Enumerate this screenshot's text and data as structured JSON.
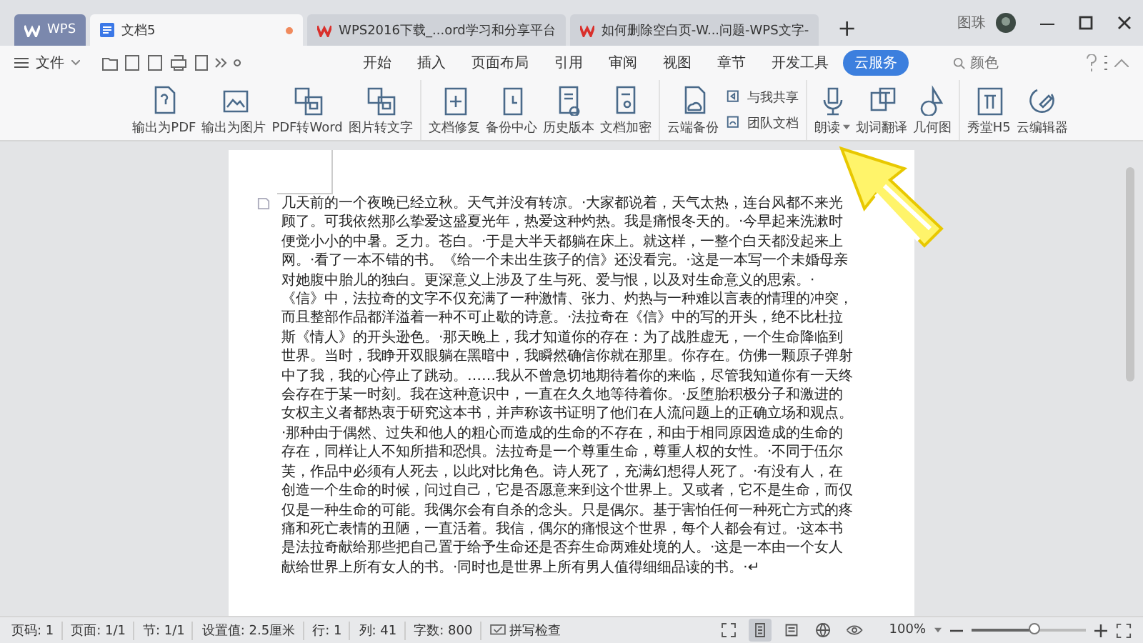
{
  "window": {
    "tabs": [
      {
        "kind": "logo",
        "label": "WPS",
        "selected": false
      },
      {
        "kind": "doc",
        "label": "文档5",
        "selected": true
      },
      {
        "kind": "web",
        "label": "WPS2016下载_...ord学习和分享平台",
        "selected": false
      },
      {
        "kind": "web",
        "label": "如何删除空白页-W...问题-WPS文字-",
        "selected": false
      }
    ],
    "new_tab": "+",
    "user": "图珠"
  },
  "menu": {
    "file": "文件"
  },
  "ribbon_tabs": [
    {
      "label": "开始",
      "selected": false
    },
    {
      "label": "插入",
      "selected": false
    },
    {
      "label": "页面布局",
      "selected": false
    },
    {
      "label": "引用",
      "selected": false
    },
    {
      "label": "审阅",
      "selected": false
    },
    {
      "label": "视图",
      "selected": false
    },
    {
      "label": "章节",
      "selected": false
    },
    {
      "label": "开发工具",
      "selected": false
    },
    {
      "label": "云服务",
      "selected": true
    }
  ],
  "search": {
    "placeholder": "颜色"
  },
  "ribbon_groups": [
    [
      {
        "kind": "large",
        "label": "输出为PDF"
      },
      {
        "kind": "large",
        "label": "输出为图片"
      },
      {
        "kind": "large",
        "label": "PDF转Word"
      },
      {
        "kind": "large",
        "label": "图片转文字"
      }
    ],
    [
      {
        "kind": "large",
        "label": "文档修复"
      },
      {
        "kind": "large",
        "label": "备份中心"
      },
      {
        "kind": "large",
        "label": "历史版本"
      },
      {
        "kind": "large",
        "label": "文档加密"
      }
    ],
    [
      {
        "kind": "large",
        "label": "云端备份"
      },
      {
        "kind": "small",
        "label": "与我共享"
      },
      {
        "kind": "small",
        "label": "团队文档"
      }
    ],
    [
      {
        "kind": "dropdown",
        "label": "朗读"
      },
      {
        "kind": "large",
        "label": "划词翻译"
      },
      {
        "kind": "large",
        "label": "几何图"
      }
    ],
    [
      {
        "kind": "large",
        "label": "秀堂H5"
      },
      {
        "kind": "large",
        "label": "云编辑器"
      }
    ]
  ],
  "document": {
    "text": "几天前的一个夜晚已经立秋。天气并没有转凉。·大家都说着，天气太热，连台风都不来光顾了。可我依然那么挚爱这盛夏光年，热爱这种灼热。我是痛恨冬天的。·今早起来洗漱时便觉小小的中暑。乏力。苍白。·于是大半天都躺在床上。就这样，一整个白天都没起来上网。·看了一本不错的书。《给一个未出生孩子的信》还没看完。·这是一本写一个未婚母亲对她腹中胎儿的独白。更深意义上涉及了生与死、爱与恨，以及对生命意义的思索。·《信》中，法拉奇的文字不仅充满了一种激情、张力、灼热与一种难以言表的情理的冲突，而且整部作品都洋溢着一种不可止歇的诗意。·法拉奇在《信》中的写的开头，绝不比杜拉斯《情人》的开头逊色。·那天晚上，我才知道你的存在：为了战胜虚无，一个生命降临到世界。当时，我睁开双眼躺在黑暗中，我瞬然确信你就在那里。你存在。仿佛一颗原子弹射中了我，我的心停止了跳动。……我从不曾急切地期待着你的来临，尽管我知道你有一天终会存在于某一时刻。我在这种意识中，一直在久久地等待着你。·反堕胎积极分子和激进的女权主义者都热衷于研究这本书，并声称该书证明了他们在人流问题上的正确立场和观点。·那种由于偶然、过失和他人的粗心而造成的生命的不存在，和由于相同原因造成的生命的存在，同样让人不知所措和恐惧。法拉奇是一个尊重生命，尊重人权的女性。·不同于伍尔芙，作品中必须有人死去，以此对比角色。诗人死了，充满幻想得人死了。·有没有人，在创造一个生命的时候，问过自己，它是否愿意来到这个世界上。又或者，它不是生命，而仅仅是一种生命的可能。我偶尔会有自杀的念头。只是偶尔。基于害怕任何一种死亡方式的疼痛和死亡表情的丑陋，一直活着。我信，偶尔的痛恨这个世界，每个人都会有过。·这本书是法拉奇献给那些把自己置于给予生命还是否弃生命两难处境的人。·这是一本由一个女人献给世界上所有女人的书。·同时也是世界上所有男人值得细细品读的书。·↵"
  },
  "status_bar": {
    "items": [
      "页码: 1",
      "页面: 1/1",
      "节: 1/1",
      "设置值: 2.5厘米",
      "行: 1",
      "列: 41",
      "字数: 800"
    ],
    "spell_check": "拼写检查",
    "views": [
      {
        "kind": "fullscreen",
        "selected": false
      },
      {
        "kind": "page",
        "selected": true
      },
      {
        "kind": "outline",
        "selected": false
      },
      {
        "kind": "web",
        "selected": false
      },
      {
        "kind": "eye",
        "selected": false
      }
    ],
    "zoom": "100%",
    "zoom_slider": {
      "level": 0.55
    }
  }
}
